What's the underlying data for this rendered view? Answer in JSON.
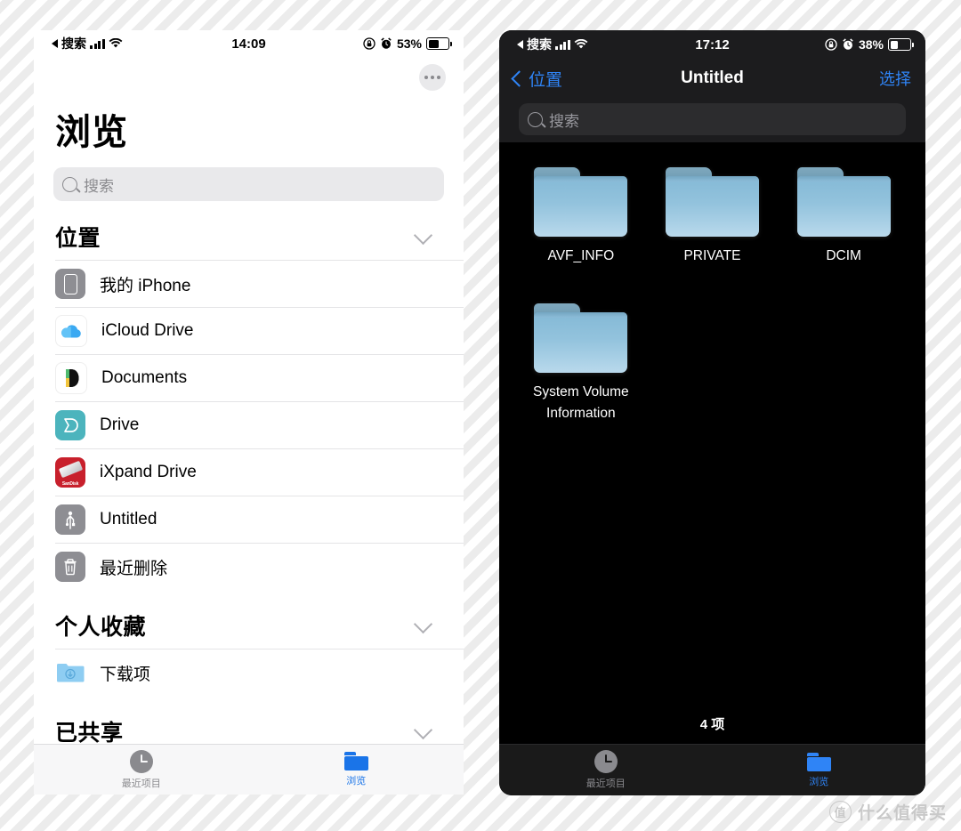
{
  "background": {
    "base_color": "#ffffff",
    "stripe_color": "#ececec"
  },
  "left_phone": {
    "status_bar": {
      "carrier_back": "◀ 搜索",
      "back_label": "搜索",
      "time": "14:09",
      "battery_percent": "53%",
      "icons": [
        "signal-bars-icon",
        "wifi-icon",
        "rotation-lock-icon",
        "alarm-icon",
        "battery-icon"
      ]
    },
    "more_button": "more-button",
    "title": "浏览",
    "search": {
      "placeholder": "搜索",
      "value": ""
    },
    "sections": [
      {
        "title": "位置",
        "collapsed": false,
        "items": [
          {
            "label": "我的 iPhone",
            "icon": "iphone-icon"
          },
          {
            "label": "iCloud Drive",
            "icon": "icloud-icon"
          },
          {
            "label": "Documents",
            "icon": "documents-app-icon"
          },
          {
            "label": "Drive",
            "icon": "drive-app-icon"
          },
          {
            "label": "iXpand Drive",
            "icon": "sandisk-ixpand-icon"
          },
          {
            "label": "Untitled",
            "icon": "usb-drive-icon"
          },
          {
            "label": "最近删除",
            "icon": "trash-icon"
          }
        ]
      },
      {
        "title": "个人收藏",
        "collapsed": false,
        "items": [
          {
            "label": "下载项",
            "icon": "downloads-folder-icon"
          }
        ]
      },
      {
        "title": "已共享",
        "collapsed": false,
        "items": []
      }
    ],
    "tabs": [
      {
        "label": "最近项目",
        "icon": "clock-icon",
        "active": false
      },
      {
        "label": "浏览",
        "icon": "folder-icon",
        "active": true
      }
    ]
  },
  "right_phone": {
    "status_bar": {
      "carrier_back": "◀ 搜索",
      "back_label": "搜索",
      "time": "17:12",
      "battery_percent": "38%",
      "icons": [
        "signal-bars-icon",
        "wifi-icon",
        "rotation-lock-icon",
        "alarm-icon",
        "battery-icon"
      ]
    },
    "nav": {
      "back_label": "位置",
      "title": "Untitled",
      "action_label": "选择"
    },
    "search": {
      "placeholder": "搜索",
      "value": ""
    },
    "folders": [
      {
        "label": "AVF_INFO",
        "icon": "folder-icon"
      },
      {
        "label": "PRIVATE",
        "icon": "folder-icon"
      },
      {
        "label": "DCIM",
        "icon": "folder-icon"
      },
      {
        "label": "System Volume Information",
        "icon": "folder-icon"
      }
    ],
    "item_count": "4 项",
    "tabs": [
      {
        "label": "最近项目",
        "icon": "clock-icon",
        "active": false
      },
      {
        "label": "浏览",
        "icon": "folder-icon",
        "active": true
      }
    ]
  },
  "watermark": {
    "logo_char": "值",
    "text": "什么值得买"
  },
  "colors": {
    "accent_light": "#1a74e8",
    "accent_dark": "#2f84f6",
    "folder_blue": "#93c3dd",
    "dark_bg": "#000000",
    "dark_chrome": "#1c1c1e"
  }
}
